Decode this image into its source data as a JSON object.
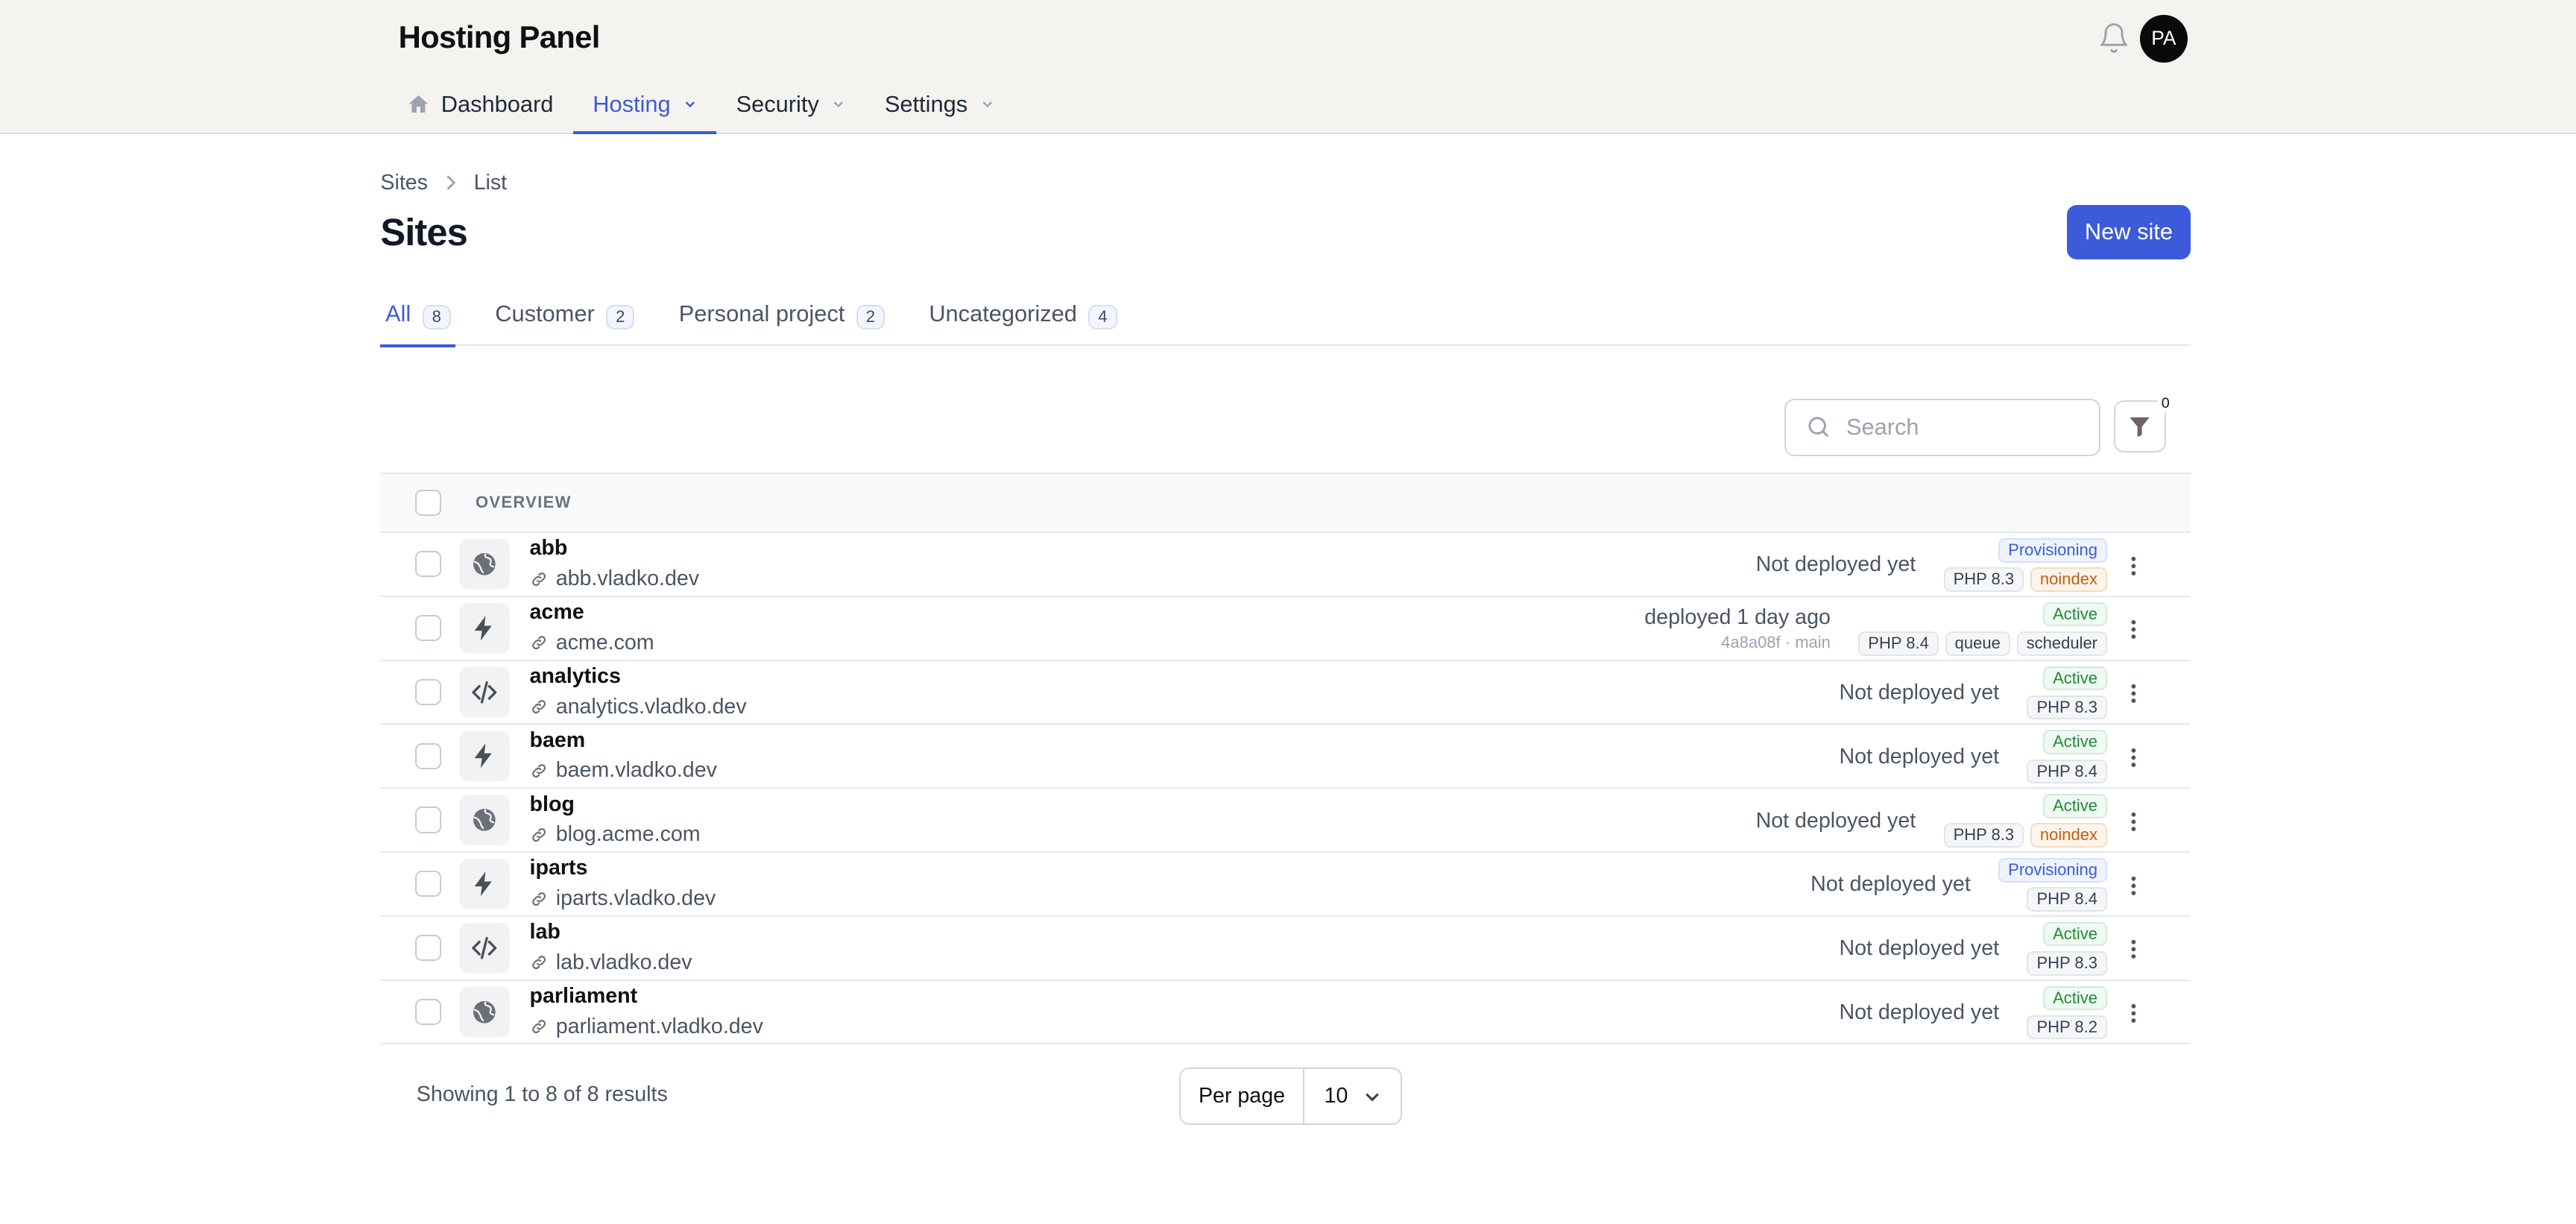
{
  "app": {
    "title": "Hosting Panel"
  },
  "header": {
    "avatar_initials": "PA"
  },
  "nav": {
    "items": [
      {
        "label": "Dashboard",
        "icon": "home-icon",
        "active": false
      },
      {
        "label": "Hosting",
        "icon": "chevron-down-icon",
        "active": true
      },
      {
        "label": "Security",
        "icon": "chevron-down-icon",
        "active": false
      },
      {
        "label": "Settings",
        "icon": "chevron-down-icon",
        "active": false
      }
    ]
  },
  "breadcrumb": [
    "Sites",
    "List"
  ],
  "page": {
    "title": "Sites",
    "new_button": "New site"
  },
  "tabs": [
    {
      "label": "All",
      "count": "8",
      "active": true
    },
    {
      "label": "Customer",
      "count": "2"
    },
    {
      "label": "Personal project",
      "count": "2"
    },
    {
      "label": "Uncategorized",
      "count": "4"
    }
  ],
  "search": {
    "placeholder": "Search",
    "value": ""
  },
  "filter": {
    "count": "0"
  },
  "table": {
    "header": "OVERVIEW",
    "rows": [
      {
        "name": "abb",
        "domain": "abb.vladko.dev",
        "icon": "globe-icon",
        "deploy": "Not deployed yet",
        "deploy_sub": "",
        "status": "Provisioning",
        "tags": [
          "PHP 8.3",
          "noindex"
        ]
      },
      {
        "name": "acme",
        "domain": "acme.com",
        "icon": "lightning-icon",
        "deploy": "deployed 1 day ago",
        "deploy_sub": "4a8a08f · main",
        "status": "Active",
        "tags": [
          "PHP 8.4",
          "queue",
          "scheduler"
        ]
      },
      {
        "name": "analytics",
        "domain": "analytics.vladko.dev",
        "icon": "code-icon",
        "deploy": "Not deployed yet",
        "deploy_sub": "",
        "status": "Active",
        "tags": [
          "PHP 8.3"
        ]
      },
      {
        "name": "baem",
        "domain": "baem.vladko.dev",
        "icon": "lightning-icon",
        "deploy": "Not deployed yet",
        "deploy_sub": "",
        "status": "Active",
        "tags": [
          "PHP 8.4"
        ]
      },
      {
        "name": "blog",
        "domain": "blog.acme.com",
        "icon": "globe-icon",
        "deploy": "Not deployed yet",
        "deploy_sub": "",
        "status": "Active",
        "tags": [
          "PHP 8.3",
          "noindex"
        ]
      },
      {
        "name": "iparts",
        "domain": "iparts.vladko.dev",
        "icon": "lightning-icon",
        "deploy": "Not deployed yet",
        "deploy_sub": "",
        "status": "Provisioning",
        "tags": [
          "PHP 8.4"
        ]
      },
      {
        "name": "lab",
        "domain": "lab.vladko.dev",
        "icon": "code-icon",
        "deploy": "Not deployed yet",
        "deploy_sub": "",
        "status": "Active",
        "tags": [
          "PHP 8.3"
        ]
      },
      {
        "name": "parliament",
        "domain": "parliament.vladko.dev",
        "icon": "globe-icon",
        "deploy": "Not deployed yet",
        "deploy_sub": "",
        "status": "Active",
        "tags": [
          "PHP 8.2"
        ]
      }
    ]
  },
  "footer": {
    "showing": "Showing 1 to 8 of 8 results",
    "per_page_label": "Per page",
    "per_page_value": "10"
  },
  "colors": {
    "accent": "#3b5bdb",
    "topbar_bg": "#f4f3f0",
    "active_green": "#1f8a3a",
    "noindex_orange": "#c05f10"
  }
}
